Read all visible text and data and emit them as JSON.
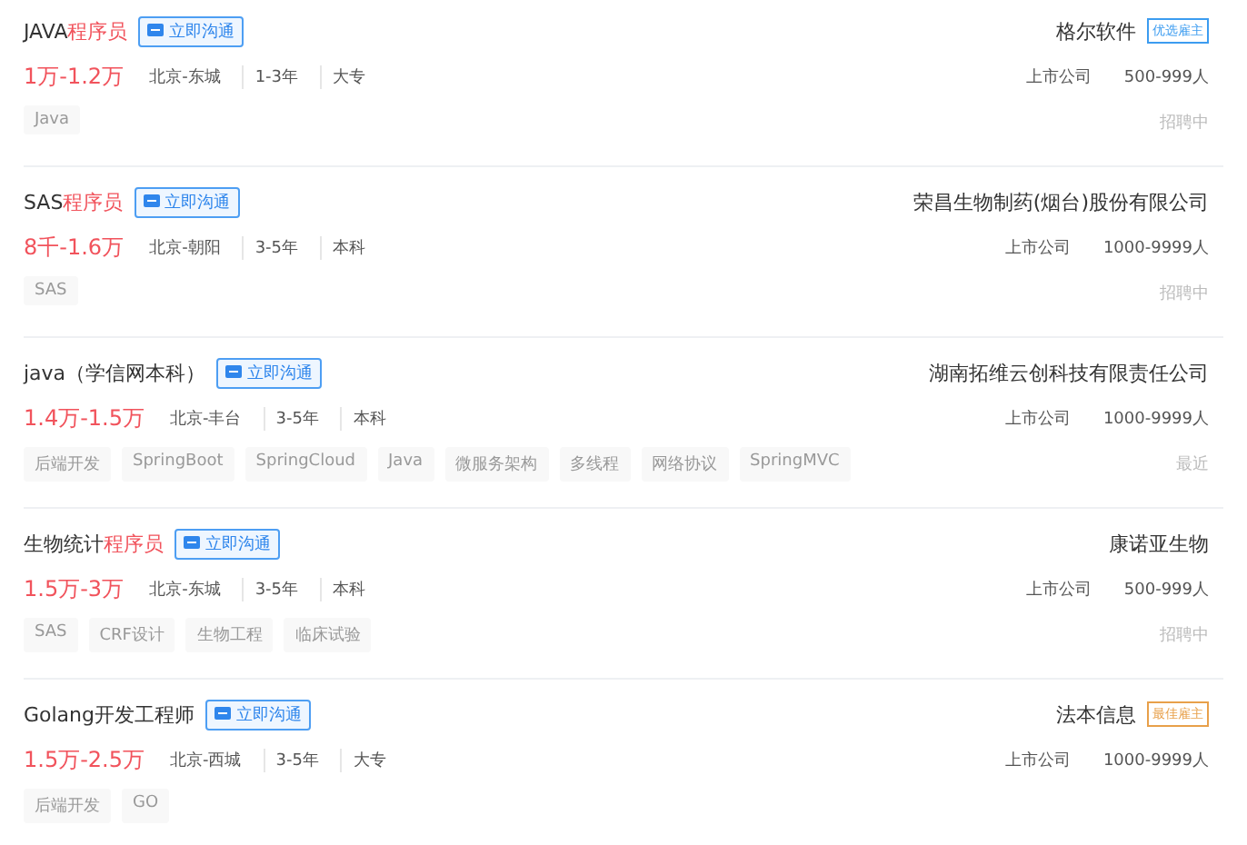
{
  "jobs": [
    {
      "title": [
        {
          "text": "JAVA",
          "highlight": false
        },
        {
          "text": "程序员",
          "highlight": true
        }
      ],
      "chat_button": "立即沟通",
      "salary": "1万-1.2万",
      "meta": [
        "北京-东城",
        "1-3年",
        "大专"
      ],
      "tags": [
        "Java"
      ],
      "company": "格尔软件",
      "badge": {
        "text": "优选雇主",
        "color": "#3c9cf0"
      },
      "company_info": [
        "上市公司",
        "500-999人"
      ],
      "status": "招聘中"
    },
    {
      "title": [
        {
          "text": "SAS",
          "highlight": false
        },
        {
          "text": "程序员",
          "highlight": true
        }
      ],
      "chat_button": "立即沟通",
      "salary": "8千-1.6万",
      "meta": [
        "北京-朝阳",
        "3-5年",
        "本科"
      ],
      "tags": [
        "SAS"
      ],
      "company": "荣昌生物制药(烟台)股份有限公司",
      "company_info": [
        "上市公司",
        "1000-9999人"
      ],
      "status": "招聘中"
    },
    {
      "title": [
        {
          "text": "java（学信网本科）",
          "highlight": false
        }
      ],
      "chat_button": "立即沟通",
      "salary": "1.4万-1.5万",
      "meta": [
        "北京-丰台",
        "3-5年",
        "本科"
      ],
      "tags": [
        "后端开发",
        "SpringBoot",
        "SpringCloud",
        "Java",
        "微服务架构",
        "多线程",
        "网络协议",
        "SpringMVC"
      ],
      "company": "湖南拓维云创科技有限责任公司",
      "company_info": [
        "上市公司",
        "1000-9999人"
      ],
      "status": "最近"
    },
    {
      "title": [
        {
          "text": "生物统计",
          "highlight": false
        },
        {
          "text": "程序员",
          "highlight": true
        }
      ],
      "chat_button": "立即沟通",
      "salary": "1.5万-3万",
      "meta": [
        "北京-东城",
        "3-5年",
        "本科"
      ],
      "tags": [
        "SAS",
        "CRF设计",
        "生物工程",
        "临床试验"
      ],
      "company": "康诺亚生物",
      "company_info": [
        "上市公司",
        "500-999人"
      ],
      "status": "招聘中"
    },
    {
      "title": [
        {
          "text": "Golang开发工程师",
          "highlight": false
        }
      ],
      "chat_button": "立即沟通",
      "salary": "1.5万-2.5万",
      "meta": [
        "北京-西城",
        "3-5年",
        "大专"
      ],
      "tags": [
        "后端开发",
        "GO"
      ],
      "company": "法本信息",
      "badge": {
        "text": "最佳雇主",
        "color": "#e8a04a"
      },
      "company_info": [
        "上市公司",
        "1000-9999人"
      ]
    }
  ]
}
